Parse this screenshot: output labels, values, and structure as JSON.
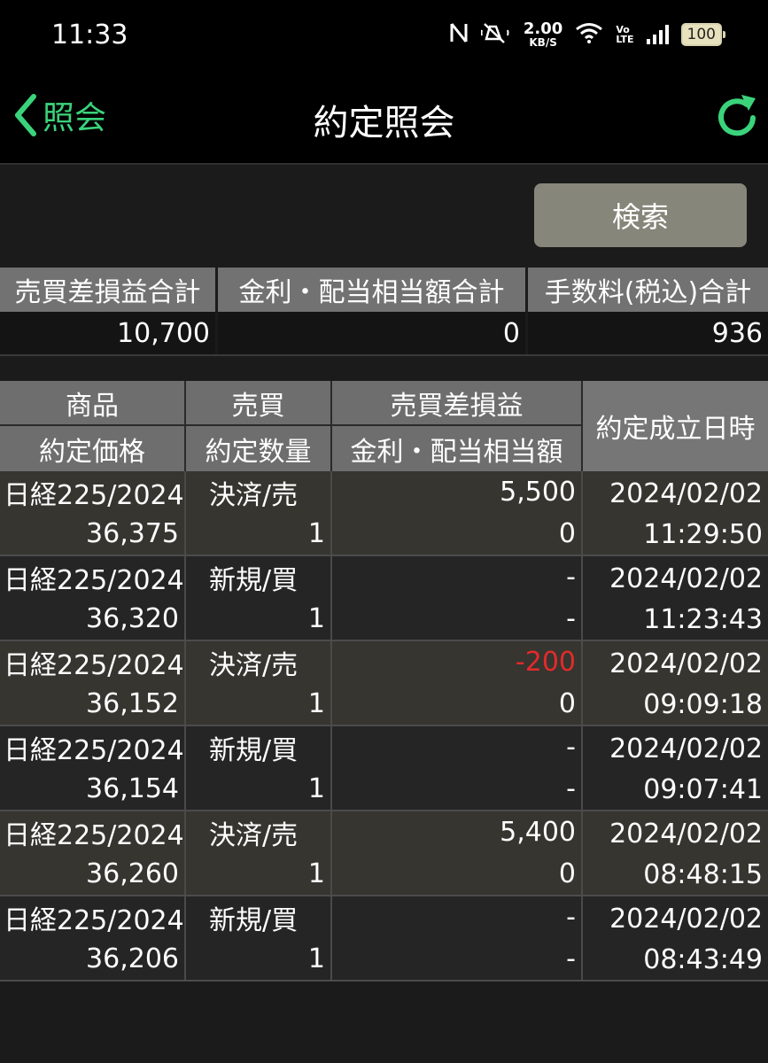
{
  "status_bar": {
    "time": "11:33",
    "net_speed_value": "2.00",
    "net_speed_unit": "KB/S",
    "volte_top": "Vo",
    "volte_bottom": "LTE",
    "battery": "100",
    "icons": [
      "nfc-icon",
      "mute-icon",
      "wifi-icon",
      "signal-icon",
      "battery-icon"
    ]
  },
  "header": {
    "back_label": "照会",
    "title": "約定照会",
    "accent_color": "#3ad37b"
  },
  "search_button": "検索",
  "summary": {
    "headers": [
      "売買差損益合計",
      "金利・配当相当額合計",
      "手数料(税込)合計"
    ],
    "values": [
      "10,700",
      "0",
      "936"
    ]
  },
  "trades": {
    "headers": {
      "product": "商品",
      "price": "約定価格",
      "side": "売買",
      "quantity": "約定数量",
      "pnl": "売買差損益",
      "interest": "金利・配当相当額",
      "datetime": "約定成立日時"
    },
    "rows": [
      {
        "product": "日経225/2024",
        "side": "決済/売",
        "pnl": "5,500",
        "date": "2024/02/02",
        "price": "36,375",
        "qty": "1",
        "interest": "0",
        "time": "11:29:50",
        "pnl_negative": false
      },
      {
        "product": "日経225/2024",
        "side": "新規/買",
        "pnl": "-",
        "date": "2024/02/02",
        "price": "36,320",
        "qty": "1",
        "interest": "-",
        "time": "11:23:43",
        "pnl_negative": false
      },
      {
        "product": "日経225/2024",
        "side": "決済/売",
        "pnl": "-200",
        "date": "2024/02/02",
        "price": "36,152",
        "qty": "1",
        "interest": "0",
        "time": "09:09:18",
        "pnl_negative": true
      },
      {
        "product": "日経225/2024",
        "side": "新規/買",
        "pnl": "-",
        "date": "2024/02/02",
        "price": "36,154",
        "qty": "1",
        "interest": "-",
        "time": "09:07:41",
        "pnl_negative": false
      },
      {
        "product": "日経225/2024",
        "side": "決済/売",
        "pnl": "5,400",
        "date": "2024/02/02",
        "price": "36,260",
        "qty": "1",
        "interest": "0",
        "time": "08:48:15",
        "pnl_negative": false
      },
      {
        "product": "日経225/2024",
        "side": "新規/買",
        "pnl": "-",
        "date": "2024/02/02",
        "price": "36,206",
        "qty": "1",
        "interest": "-",
        "time": "08:43:49",
        "pnl_negative": false
      }
    ]
  }
}
